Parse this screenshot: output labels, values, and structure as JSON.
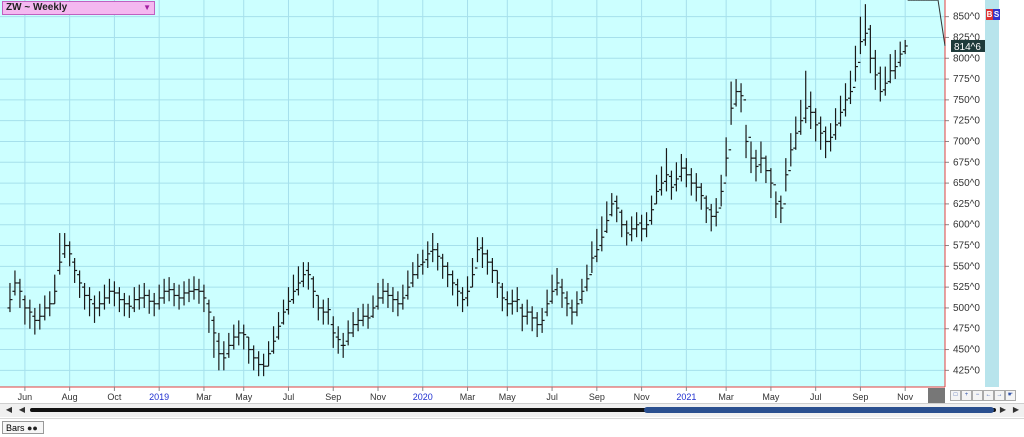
{
  "header": {
    "title": "ZW ~ Weekly",
    "dropdown_icon": "triangle-down-icon"
  },
  "badge": {
    "b": "B",
    "s": "S"
  },
  "status": {
    "tab_label": "Bars",
    "tab_icon": "binoculars-icon"
  },
  "nav": {
    "icons": [
      "zoom-fit-icon",
      "zoom-in-icon",
      "zoom-out-icon",
      "shift-left-icon",
      "shift-right-icon",
      "hand-icon"
    ]
  },
  "chart_data": {
    "type": "ohlc",
    "title": "ZW ~ Weekly",
    "price_axis": {
      "ticks": [
        "425^0",
        "450^0",
        "475^0",
        "500^0",
        "525^0",
        "550^0",
        "575^0",
        "600^0",
        "625^0",
        "650^0",
        "675^0",
        "700^0",
        "725^0",
        "750^0",
        "775^0",
        "800^0",
        "825^0",
        "850^0"
      ],
      "tick_values": [
        425,
        450,
        475,
        500,
        525,
        550,
        575,
        600,
        625,
        650,
        675,
        700,
        725,
        750,
        775,
        800,
        825,
        850
      ],
      "range": [
        405,
        870
      ],
      "last_price_label": "814^6",
      "last_price": 814.75
    },
    "time_axis": {
      "labels": [
        "Jun",
        "Aug",
        "Oct",
        "2019",
        "Mar",
        "May",
        "Jul",
        "Sep",
        "Nov",
        "2020",
        "Mar",
        "May",
        "Jul",
        "Sep",
        "Nov",
        "2021",
        "Mar",
        "May",
        "Jul",
        "Sep",
        "Nov"
      ],
      "year_labels": [
        "2019",
        "2020",
        "2021"
      ],
      "label_weeks": [
        3,
        12,
        21,
        30,
        39,
        47,
        56,
        65,
        74,
        83,
        92,
        100,
        109,
        118,
        127,
        136,
        144,
        153,
        162,
        171,
        180
      ]
    },
    "colors": {
      "background": "#ccffff",
      "grid": "#a6e0ec",
      "bars": "#1a1a1a",
      "axis_line": "#e04040",
      "year_label": "#2030d0"
    },
    "grid": true,
    "weeks": [
      0,
      1,
      2,
      3,
      4,
      5,
      6,
      7,
      8,
      9,
      10,
      11,
      12,
      13,
      14,
      15,
      16,
      17,
      18,
      19,
      20,
      21,
      22,
      23,
      24,
      25,
      26,
      27,
      28,
      29,
      30,
      31,
      32,
      33,
      34,
      35,
      36,
      37,
      38,
      39,
      40,
      41,
      42,
      43,
      44,
      45,
      46,
      47,
      48,
      49,
      50,
      51,
      52,
      53,
      54,
      55,
      56,
      57,
      58,
      59,
      60,
      61,
      62,
      63,
      64,
      65,
      66,
      67,
      68,
      69,
      70,
      71,
      72,
      73,
      74,
      75,
      76,
      77,
      78,
      79,
      80,
      81,
      82,
      83,
      84,
      85,
      86,
      87,
      88,
      89,
      90,
      91,
      92,
      93,
      94,
      95,
      96,
      97,
      98,
      99,
      100,
      101,
      102,
      103,
      104,
      105,
      106,
      107,
      108,
      109,
      110,
      111,
      112,
      113,
      114,
      115,
      116,
      117,
      118,
      119,
      120,
      121,
      122,
      123,
      124,
      125,
      126,
      127,
      128,
      129,
      130,
      131,
      132,
      133,
      134,
      135,
      136,
      137,
      138,
      139,
      140,
      141,
      142,
      143,
      144,
      145,
      146,
      147,
      148,
      149,
      150,
      151,
      152,
      153,
      154,
      155,
      156,
      157,
      158,
      159,
      160,
      161,
      162,
      163,
      164,
      165,
      166,
      167,
      168,
      169,
      170,
      171,
      172,
      173,
      174,
      175,
      176,
      177,
      178,
      179,
      180,
      181,
      182,
      183,
      184,
      185,
      186
    ],
    "close": [
      510,
      530,
      520,
      500,
      495,
      485,
      490,
      500,
      505,
      520,
      555,
      575,
      565,
      545,
      530,
      515,
      510,
      500,
      505,
      512,
      520,
      518,
      510,
      505,
      502,
      510,
      512,
      515,
      508,
      505,
      512,
      520,
      522,
      515,
      512,
      518,
      520,
      522,
      520,
      512,
      495,
      470,
      445,
      440,
      455,
      465,
      470,
      468,
      450,
      440,
      432,
      430,
      445,
      460,
      478,
      495,
      508,
      520,
      530,
      540,
      540,
      520,
      500,
      495,
      498,
      470,
      462,
      455,
      470,
      480,
      485,
      490,
      488,
      500,
      512,
      520,
      515,
      510,
      505,
      512,
      525,
      540,
      550,
      555,
      565,
      570,
      562,
      550,
      540,
      530,
      520,
      510,
      520,
      540,
      570,
      565,
      555,
      545,
      530,
      512,
      505,
      508,
      510,
      490,
      495,
      488,
      480,
      485,
      505,
      520,
      530,
      518,
      505,
      495,
      505,
      520,
      535,
      560,
      570,
      585,
      605,
      625,
      620,
      600,
      590,
      595,
      600,
      595,
      600,
      618,
      640,
      650,
      660,
      645,
      655,
      668,
      660,
      650,
      645,
      635,
      620,
      610,
      615,
      640,
      680,
      740,
      760,
      755,
      700,
      680,
      670,
      680,
      665,
      650,
      625,
      620,
      660,
      690,
      710,
      725,
      740,
      735,
      720,
      710,
      700,
      705,
      720,
      735,
      750,
      760,
      790,
      820,
      830,
      800,
      780,
      760,
      770,
      785,
      790,
      805,
      814.75
    ],
    "high": [
      530,
      545,
      535,
      515,
      510,
      500,
      505,
      515,
      520,
      540,
      590,
      590,
      580,
      560,
      545,
      530,
      525,
      515,
      520,
      528,
      535,
      532,
      525,
      518,
      515,
      525,
      528,
      530,
      522,
      518,
      528,
      535,
      537,
      530,
      528,
      532,
      535,
      538,
      535,
      528,
      510,
      490,
      470,
      460,
      470,
      480,
      485,
      480,
      465,
      455,
      448,
      445,
      460,
      478,
      495,
      510,
      525,
      540,
      550,
      555,
      555,
      538,
      515,
      510,
      512,
      490,
      478,
      470,
      485,
      495,
      500,
      505,
      505,
      515,
      530,
      535,
      530,
      525,
      520,
      528,
      545,
      555,
      565,
      570,
      580,
      590,
      578,
      565,
      555,
      545,
      535,
      525,
      538,
      560,
      585,
      585,
      570,
      560,
      545,
      530,
      520,
      522,
      525,
      505,
      510,
      502,
      495,
      500,
      522,
      540,
      548,
      535,
      520,
      510,
      520,
      535,
      552,
      580,
      595,
      610,
      628,
      638,
      635,
      618,
      605,
      610,
      615,
      612,
      615,
      635,
      660,
      670,
      692,
      665,
      675,
      685,
      680,
      668,
      662,
      650,
      635,
      625,
      632,
      660,
      705,
      772,
      775,
      770,
      720,
      700,
      690,
      700,
      683,
      668,
      640,
      635,
      680,
      710,
      730,
      750,
      785,
      760,
      740,
      730,
      718,
      722,
      740,
      755,
      770,
      785,
      815,
      850,
      865,
      840,
      810,
      790,
      790,
      805,
      810,
      820,
      822
    ],
    "low": [
      495,
      515,
      500,
      480,
      475,
      468,
      474,
      485,
      490,
      505,
      540,
      560,
      550,
      530,
      512,
      498,
      490,
      482,
      490,
      498,
      505,
      502,
      495,
      490,
      488,
      495,
      498,
      500,
      493,
      490,
      498,
      505,
      508,
      502,
      498,
      503,
      507,
      510,
      505,
      495,
      470,
      440,
      425,
      425,
      440,
      450,
      455,
      450,
      433,
      425,
      418,
      418,
      430,
      445,
      462,
      480,
      492,
      505,
      515,
      525,
      522,
      500,
      485,
      480,
      480,
      452,
      445,
      440,
      455,
      465,
      472,
      478,
      475,
      488,
      498,
      505,
      500,
      495,
      490,
      498,
      510,
      525,
      535,
      540,
      548,
      555,
      545,
      535,
      525,
      515,
      502,
      495,
      502,
      525,
      555,
      548,
      540,
      530,
      512,
      496,
      490,
      492,
      495,
      472,
      480,
      472,
      465,
      470,
      490,
      505,
      515,
      500,
      490,
      480,
      490,
      505,
      520,
      542,
      555,
      568,
      590,
      610,
      603,
      585,
      575,
      580,
      585,
      580,
      585,
      600,
      625,
      635,
      640,
      630,
      640,
      652,
      645,
      635,
      628,
      618,
      602,
      592,
      598,
      622,
      658,
      720,
      742,
      735,
      680,
      662,
      652,
      662,
      650,
      632,
      608,
      602,
      640,
      670,
      690,
      708,
      722,
      715,
      700,
      690,
      680,
      688,
      702,
      718,
      730,
      745,
      772,
      805,
      815,
      782,
      762,
      748,
      755,
      770,
      775,
      790,
      805
    ],
    "open": [
      500,
      520,
      530,
      510,
      500,
      490,
      485,
      490,
      500,
      505,
      545,
      565,
      575,
      555,
      540,
      525,
      515,
      505,
      500,
      505,
      512,
      520,
      518,
      510,
      505,
      500,
      510,
      512,
      515,
      508,
      505,
      512,
      520,
      522,
      515,
      512,
      518,
      520,
      522,
      520,
      505,
      485,
      460,
      445,
      445,
      455,
      465,
      470,
      465,
      450,
      440,
      432,
      430,
      448,
      465,
      482,
      498,
      510,
      522,
      532,
      545,
      535,
      515,
      500,
      495,
      480,
      465,
      455,
      460,
      470,
      480,
      485,
      490,
      490,
      502,
      512,
      520,
      515,
      510,
      505,
      515,
      530,
      540,
      552,
      558,
      568,
      570,
      560,
      550,
      540,
      528,
      518,
      512,
      525,
      548,
      572,
      565,
      555,
      545,
      525,
      510,
      505,
      508,
      500,
      490,
      495,
      488,
      480,
      495,
      508,
      522,
      525,
      512,
      500,
      495,
      510,
      525,
      540,
      562,
      575,
      592,
      612,
      628,
      615,
      600,
      588,
      595,
      602,
      595,
      605,
      625,
      642,
      652,
      658,
      648,
      658,
      668,
      660,
      650,
      645,
      632,
      618,
      610,
      620,
      650,
      690,
      745,
      760,
      750,
      705,
      680,
      672,
      680,
      665,
      648,
      628,
      625,
      665,
      692,
      712,
      728,
      742,
      735,
      722,
      712,
      700,
      708,
      722,
      738,
      752,
      765,
      795,
      822,
      835,
      800,
      782,
      762,
      772,
      785,
      795,
      808
    ],
    "x_range": [
      -1,
      187
    ]
  }
}
